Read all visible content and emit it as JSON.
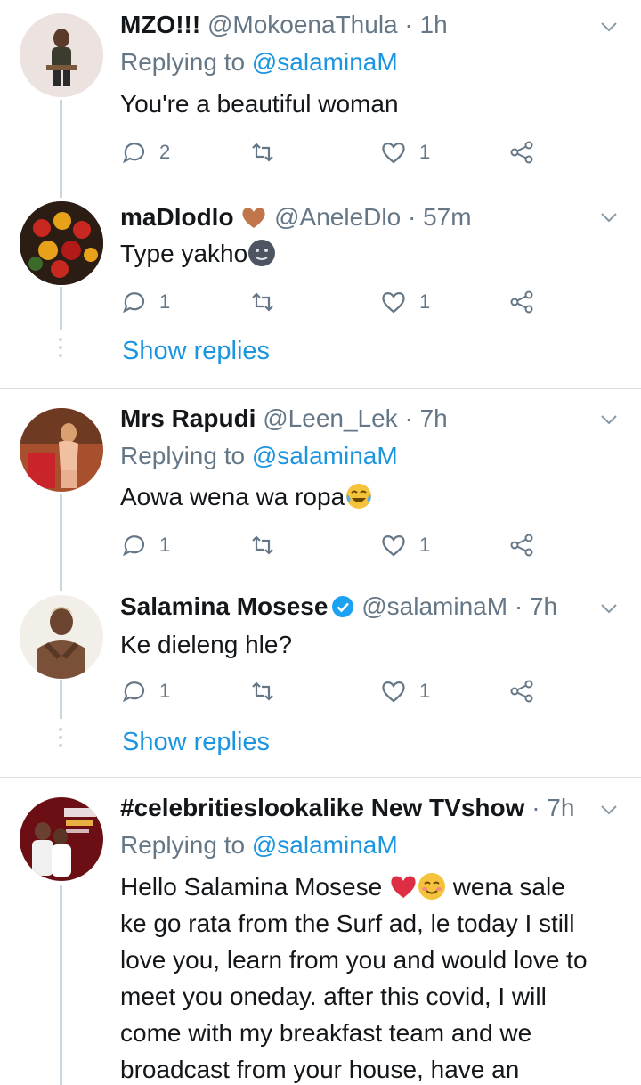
{
  "tweets": [
    {
      "name": "MZO!!!",
      "handle": "@MokoenaThula",
      "time": "1h",
      "replying_prefix": "Replying to",
      "replying_to": "@salaminaM",
      "text": "You're a beautiful woman",
      "reply_count": "2",
      "like_count": "1"
    },
    {
      "name": "maDlodlo",
      "handle": "@AneleDlo",
      "time": "57m",
      "text": "Type yakho",
      "reply_count": "1",
      "like_count": "1",
      "show_replies": "Show replies"
    },
    {
      "name": "Mrs Rapudi",
      "handle": "@Leen_Lek",
      "time": "7h",
      "replying_prefix": "Replying to",
      "replying_to": "@salaminaM",
      "text": "Aowa wena wa ropa",
      "reply_count": "1",
      "like_count": "1"
    },
    {
      "name": "Salamina Mosese",
      "handle": "@salaminaM",
      "time": "7h",
      "text": "Ke dieleng hle?",
      "reply_count": "1",
      "like_count": "1",
      "show_replies": "Show replies"
    },
    {
      "name": "#celebritieslookalike New TVshow",
      "time": "7h",
      "replying_prefix": "Replying to",
      "replying_to": "@salaminaM",
      "text_part1": "Hello Salamina Mosese",
      "text_part2": "wena sale",
      "text_lines": [
        "ke go rata from the Surf ad, le today I still",
        "love you, learn from you and would love to",
        "meet you oneday. after this covid, I will",
        "come with my breakfast team and we",
        "broadcast from your house, have an"
      ]
    }
  ],
  "separator": "·",
  "colors": {
    "accent": "#1b95e0",
    "muted": "#657786",
    "thread_line": "#ccd6dd",
    "heart_emoji": "#dd2e44"
  }
}
